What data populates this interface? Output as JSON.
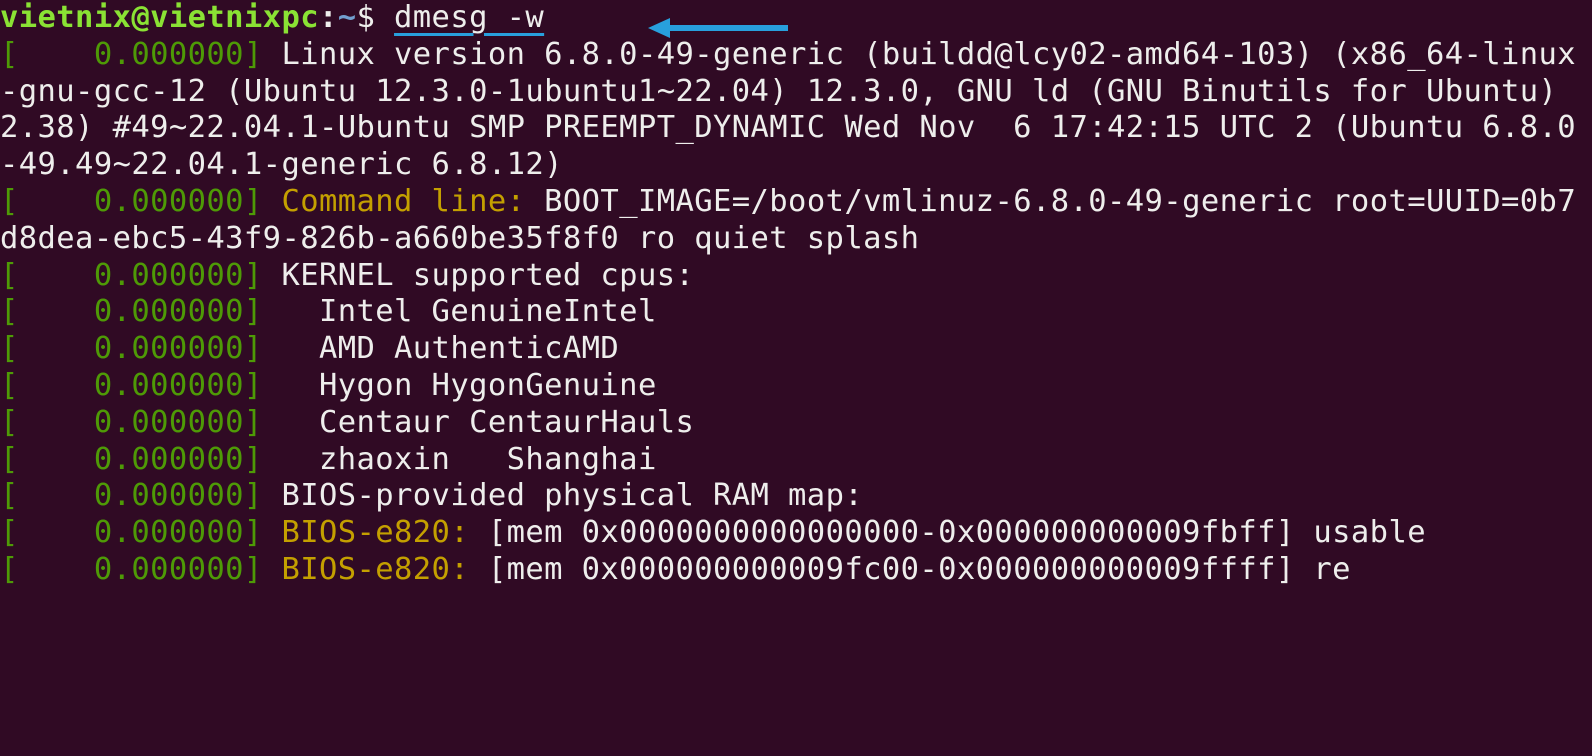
{
  "prompt": {
    "user": "vietnix@vietnixpc",
    "colon": ":",
    "path": "~",
    "dollar": "$ ",
    "command": "dmesg -w"
  },
  "arrow_color": "#28a0dd",
  "lines": [
    {
      "ts": "[    0.000000] ",
      "lbl": "",
      "txt": "Linux version 6.8.0-49-generic (buildd@lcy02-amd64-103) (x86_64-linux-gnu-gcc-12 (Ubuntu 12.3.0-1ubuntu1~22.04) 12.3.0, GNU ld (GNU Binutils for Ubuntu) 2.38) #49~22.04.1-Ubuntu SMP PREEMPT_DYNAMIC Wed Nov  6 17:42:15 UTC 2 (Ubuntu 6.8.0-49.49~22.04.1-generic 6.8.12)"
    },
    {
      "ts": "[    0.000000] ",
      "lbl": "Command line: ",
      "txt": "BOOT_IMAGE=/boot/vmlinuz-6.8.0-49-generic root=UUID=0b7d8dea-ebc5-43f9-826b-a660be35f8f0 ro quiet splash"
    },
    {
      "ts": "[    0.000000] ",
      "lbl": "",
      "txt": "KERNEL supported cpus:"
    },
    {
      "ts": "[    0.000000] ",
      "lbl": "",
      "txt": "  Intel GenuineIntel"
    },
    {
      "ts": "[    0.000000] ",
      "lbl": "",
      "txt": "  AMD AuthenticAMD"
    },
    {
      "ts": "[    0.000000] ",
      "lbl": "",
      "txt": "  Hygon HygonGenuine"
    },
    {
      "ts": "[    0.000000] ",
      "lbl": "",
      "txt": "  Centaur CentaurHauls"
    },
    {
      "ts": "[    0.000000] ",
      "lbl": "",
      "txt": "  zhaoxin   Shanghai"
    },
    {
      "ts": "[    0.000000] ",
      "lbl": "",
      "txt": "BIOS-provided physical RAM map:"
    },
    {
      "ts": "[    0.000000] ",
      "lbl": "BIOS-e820: ",
      "txt": "[mem 0x0000000000000000-0x000000000009fbff] usable"
    },
    {
      "ts": "[    0.000000] ",
      "lbl": "BIOS-e820: ",
      "txt": "[mem 0x000000000009fc00-0x000000000009ffff] re"
    }
  ]
}
